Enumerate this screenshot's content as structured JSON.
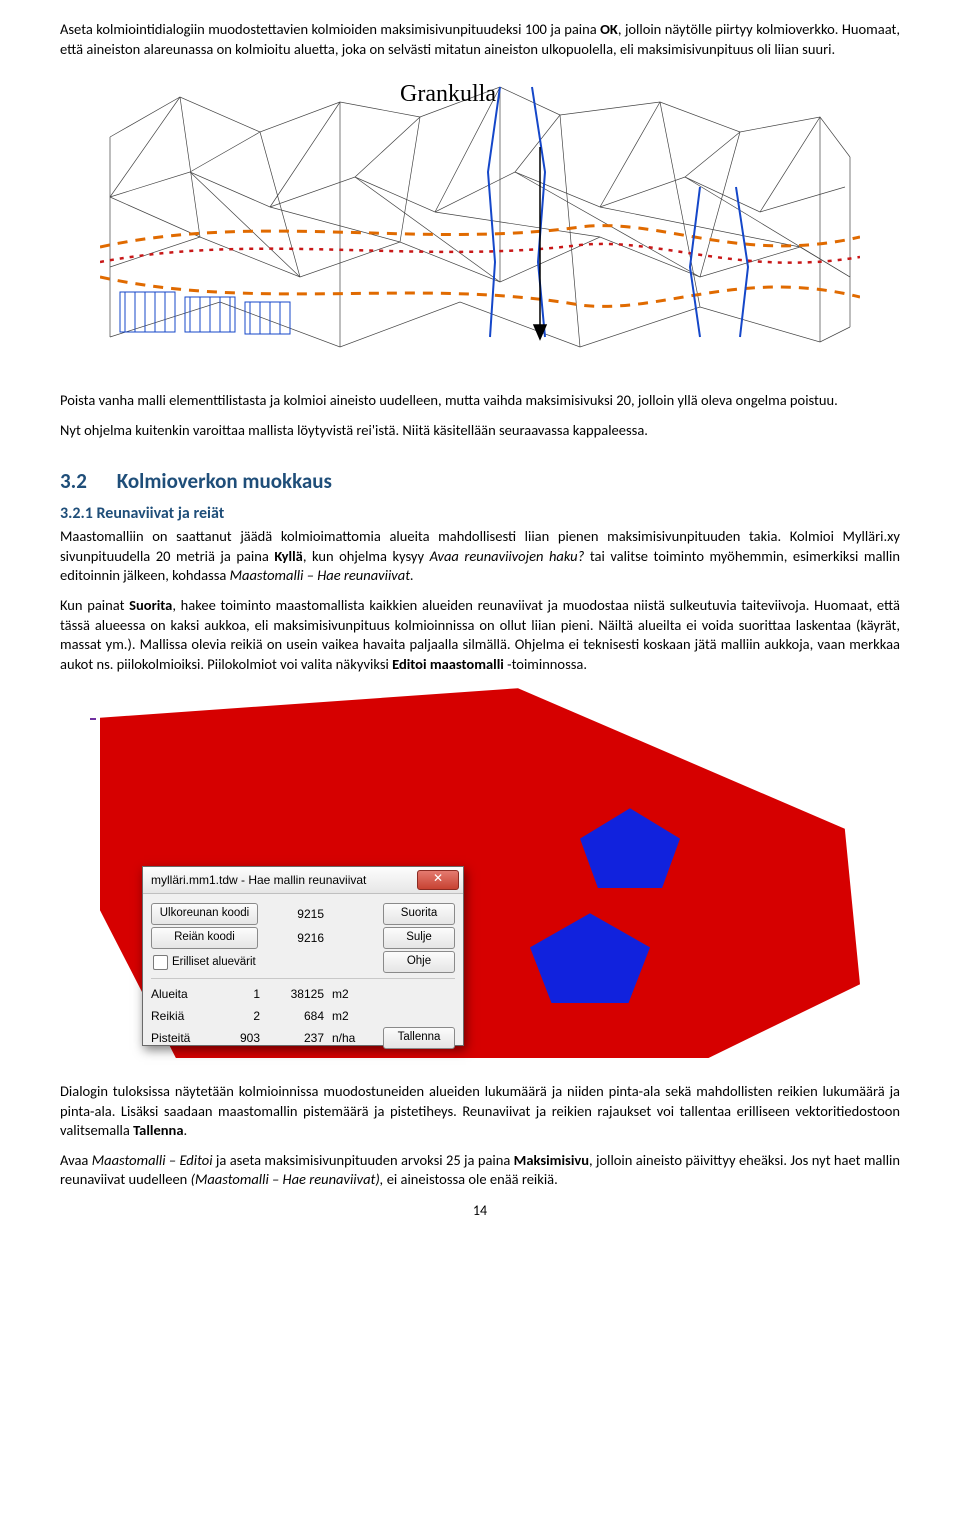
{
  "para1": "Aseta kolmiointidialogiin muodostettavien kolmioiden maksimisivunpituudeksi 100 ja paina OK, jolloin näytölle piirtyy kolmioverkko. Huomaat, että aineiston alareunassa on kolmioitu aluetta, joka on selvästi mitatun aineiston ulkopuolella, eli maksimisivunpituus oli liian suuri.",
  "fig1_label": "Grankulla",
  "para2": "Poista vanha malli elementtilistasta ja kolmioi aineisto uudelleen, mutta vaihda maksimisivuksi 20, jolloin yllä oleva ongelma poistuu.",
  "para3": "Nyt ohjelma kuitenkin varoittaa mallista löytyvistä rei'istä. Niitä käsitellään seuraavassa kappaleessa.",
  "sec_num": "3.2",
  "sec_title": "Kolmioverkon muokkaus",
  "subsec_title": "3.2.1 Reunaviivat ja reiät",
  "para4": "Maastomalliin on saattanut jäädä kolmioimattomia alueita mahdollisesti liian pienen maksimisivunpituuden takia. Kolmioi Mylläri.xy sivunpituudella 20 metriä ja paina Kyllä, kun ohjelma kysyy Avaa reunaviivojen haku? tai valitse toiminto myöhemmin, esimerkiksi mallin editoinnin jälkeen, kohdassa Maastomalli – Hae reunaviivat.",
  "para5": "Kun painat Suorita, hakee toiminto maastomallista kaikkien alueiden reunaviivat ja muodostaa niistä sulkeutuvia taiteviivoja. Huomaat, että tässä alueessa on kaksi aukkoa, eli maksimisivunpituus kolmioinnissa on ollut liian pieni. Näiltä alueilta ei voida suorittaa laskentaa (käyrät, massat ym.). Mallissa olevia reikiä on usein vaikea havaita paljaalla silmällä. Ohjelma ei teknisesti koskaan jätä malliin aukkoja, vaan merkkaa aukot ns. piilokolmioiksi. Piilokolmiot voi valita näkyviksi Editoi maastomalli -toiminnossa.",
  "dialog": {
    "title": "mylläri.mm1.tdw - Hae mallin reunaviivat",
    "btn_ulkoreuna": "Ulkoreunan koodi",
    "btn_reian": "Reiän koodi",
    "chk_erilliset": "Erilliset aluevärit",
    "val_ulkoreuna": "9215",
    "val_reian": "9216",
    "btn_suorita": "Suorita",
    "btn_sulje": "Sulje",
    "btn_ohje": "Ohje",
    "btn_tallenna": "Tallenna",
    "lab_alueita": "Alueita",
    "lab_reikia": "Reikiä",
    "lab_pisteita": "Pisteitä",
    "alueita_v1": "1",
    "alueita_v2": "38125",
    "alueita_unit": "m2",
    "reikia_v1": "2",
    "reikia_v2": "684",
    "reikia_unit": "m2",
    "pisteita_v1": "903",
    "pisteita_v2": "237",
    "pisteita_unit": "n/ha"
  },
  "para6": "Dialogin tuloksissa näytetään kolmioinnissa muodostuneiden alueiden lukumäärä ja niiden pinta-ala sekä mahdollisten reikien lukumäärä ja pinta-ala. Lisäksi saadaan maastomallin pistemäärä ja pistetiheys. Reunaviivat ja reikien rajaukset voi tallentaa erilliseen vektoritiedostoon valitsemalla Tallenna.",
  "para7": "Avaa Maastomalli – Editoi ja aseta maksimisivunpituuden arvoksi 25 ja paina Maksimisivu, jolloin aineisto päivittyy eheäksi. Jos nyt haet mallin reunaviivat uudelleen (Maastomalli – Hae reunaviivat), ei aineistossa ole enää reikiä.",
  "pagenum": "14"
}
